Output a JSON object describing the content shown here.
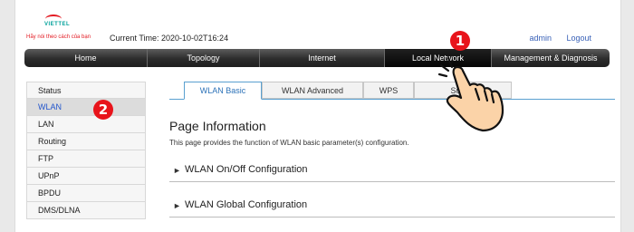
{
  "header": {
    "logo_text": "VIETTEL",
    "slogan": "Hãy nói theo cách của bạn",
    "current_time": "Current Time: 2020-10-02T16:24",
    "user_link": "admin",
    "logout_link": "Logout"
  },
  "nav": {
    "items": [
      {
        "label": "Home"
      },
      {
        "label": "Topology"
      },
      {
        "label": "Internet"
      },
      {
        "label": "Local Network"
      },
      {
        "label": "Management & Diagnosis"
      }
    ],
    "active": "Local Network"
  },
  "sidebar": {
    "items": [
      {
        "label": "Status"
      },
      {
        "label": "WLAN"
      },
      {
        "label": "LAN"
      },
      {
        "label": "Routing"
      },
      {
        "label": "FTP"
      },
      {
        "label": "UPnP"
      },
      {
        "label": "BPDU"
      },
      {
        "label": "DMS/DLNA"
      }
    ],
    "active": "WLAN"
  },
  "tabs": {
    "items": [
      {
        "label": "WLAN Basic"
      },
      {
        "label": "WLAN Advanced"
      },
      {
        "label": "WPS"
      },
      {
        "label": "Surrou"
      }
    ],
    "active": "WLAN Basic"
  },
  "main": {
    "title": "Page Information",
    "description": "This page provides the function of WLAN basic parameter(s) configuration.",
    "sections": [
      {
        "label": "WLAN On/Off Configuration",
        "arrow": "►"
      },
      {
        "label": "WLAN Global Configuration",
        "arrow": "►"
      }
    ]
  },
  "annotations": {
    "step1": "1",
    "step2": "2"
  },
  "colors": {
    "accent_red": "#e8141b",
    "link_blue": "#3a62b8",
    "tab_active_text": "#2c72b8"
  }
}
